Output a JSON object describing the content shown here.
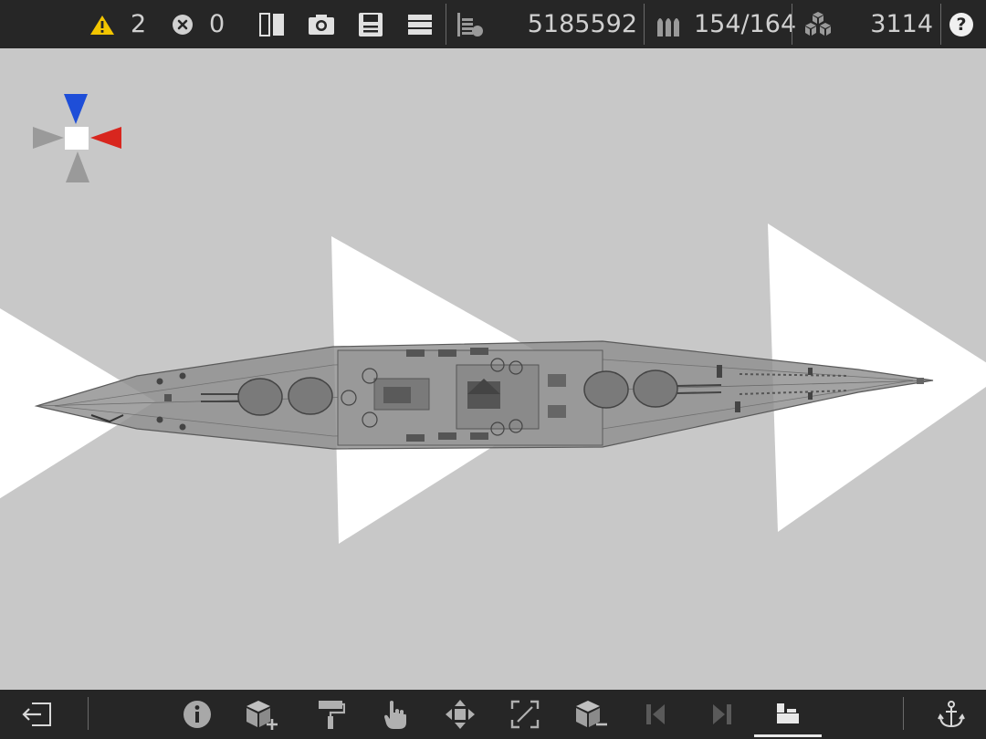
{
  "status": {
    "warnings_count": "2",
    "errors_count": "0",
    "score_value": "5185592",
    "ammo_value": "154/164",
    "parts_value": "3114",
    "help_label": "?"
  },
  "colors": {
    "bar_bg": "#262626",
    "viewport_bg": "#c8c8c8",
    "warning_yellow": "#f2c500",
    "compass_blue": "#1e4ed8",
    "compass_red": "#d8261e"
  },
  "toolbar_icons": [
    "mirror-icon",
    "camera-icon",
    "save-icon",
    "menu-icon",
    "weight-icon",
    "ammo-icon",
    "parts-icon",
    "help-icon"
  ],
  "bottom_toolbar_icons": [
    "exit-icon",
    "info-icon",
    "add-part-icon",
    "paint-roller-icon",
    "hand-pointer-icon",
    "move-icon",
    "resize-icon",
    "remove-part-icon",
    "previous-icon",
    "next-icon",
    "ship-view-icon",
    "anchor-icon"
  ]
}
